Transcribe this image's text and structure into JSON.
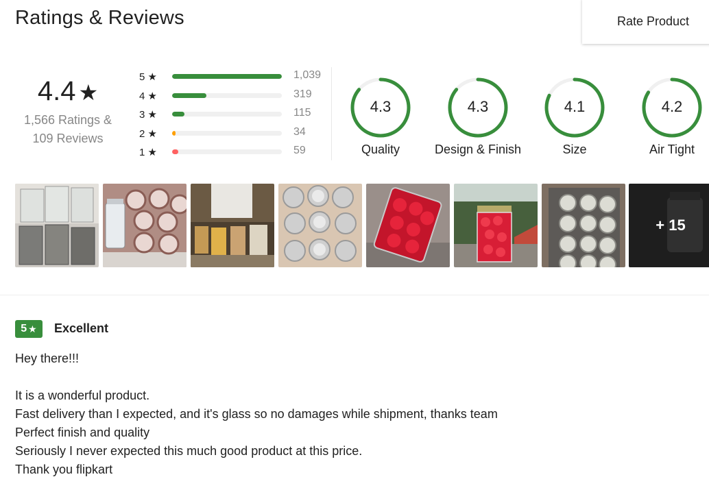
{
  "header": {
    "title": "Ratings & Reviews",
    "rate_button": "Rate Product"
  },
  "summary": {
    "average": "4.4",
    "star_glyph": "★",
    "ratings_text": "1,566 Ratings &",
    "reviews_text": "109 Reviews"
  },
  "distribution": [
    {
      "label": "5 ★",
      "count": "1,039",
      "fraction": 1.0,
      "color": "#388e3c"
    },
    {
      "label": "4 ★",
      "count": "319",
      "fraction": 0.31,
      "color": "#388e3c"
    },
    {
      "label": "3 ★",
      "count": "115",
      "fraction": 0.11,
      "color": "#388e3c"
    },
    {
      "label": "2 ★",
      "count": "34",
      "fraction": 0.033,
      "color": "#ff9f00"
    },
    {
      "label": "1 ★",
      "count": "59",
      "fraction": 0.057,
      "color": "#ff6161"
    }
  ],
  "aspects": [
    {
      "value": "4.3",
      "label": "Quality",
      "fraction": 0.86
    },
    {
      "value": "4.3",
      "label": "Design & Finish",
      "fraction": 0.86
    },
    {
      "value": "4.1",
      "label": "Size",
      "fraction": 0.82
    },
    {
      "value": "4.2",
      "label": "Air Tight",
      "fraction": 0.84
    }
  ],
  "photos": {
    "items": [
      {
        "name": "photo-empty-jars"
      },
      {
        "name": "photo-jars-in-box"
      },
      {
        "name": "photo-filled-jars-shelf"
      },
      {
        "name": "photo-jar-lids-box"
      },
      {
        "name": "photo-red-fruit-jar-closeup"
      },
      {
        "name": "photo-red-fruit-jar-outdoor"
      },
      {
        "name": "photo-jars-carton"
      },
      {
        "name": "photo-more-photos"
      }
    ],
    "more_label": "+ 15"
  },
  "review": {
    "rating": "5",
    "star_glyph": "★",
    "title": "Excellent",
    "lines": [
      "Hey there!!!",
      "",
      "It is a wonderful product.",
      "Fast delivery than I expected, and it's glass so no damages while shipment, thanks team",
      "Perfect finish and quality",
      "Seriously I never expected this much good product at this price.",
      "Thank you flipkart"
    ]
  },
  "colors": {
    "accent_green": "#388e3c",
    "orange": "#ff9f00",
    "red": "#ff6161",
    "track": "#f0f0f0"
  }
}
